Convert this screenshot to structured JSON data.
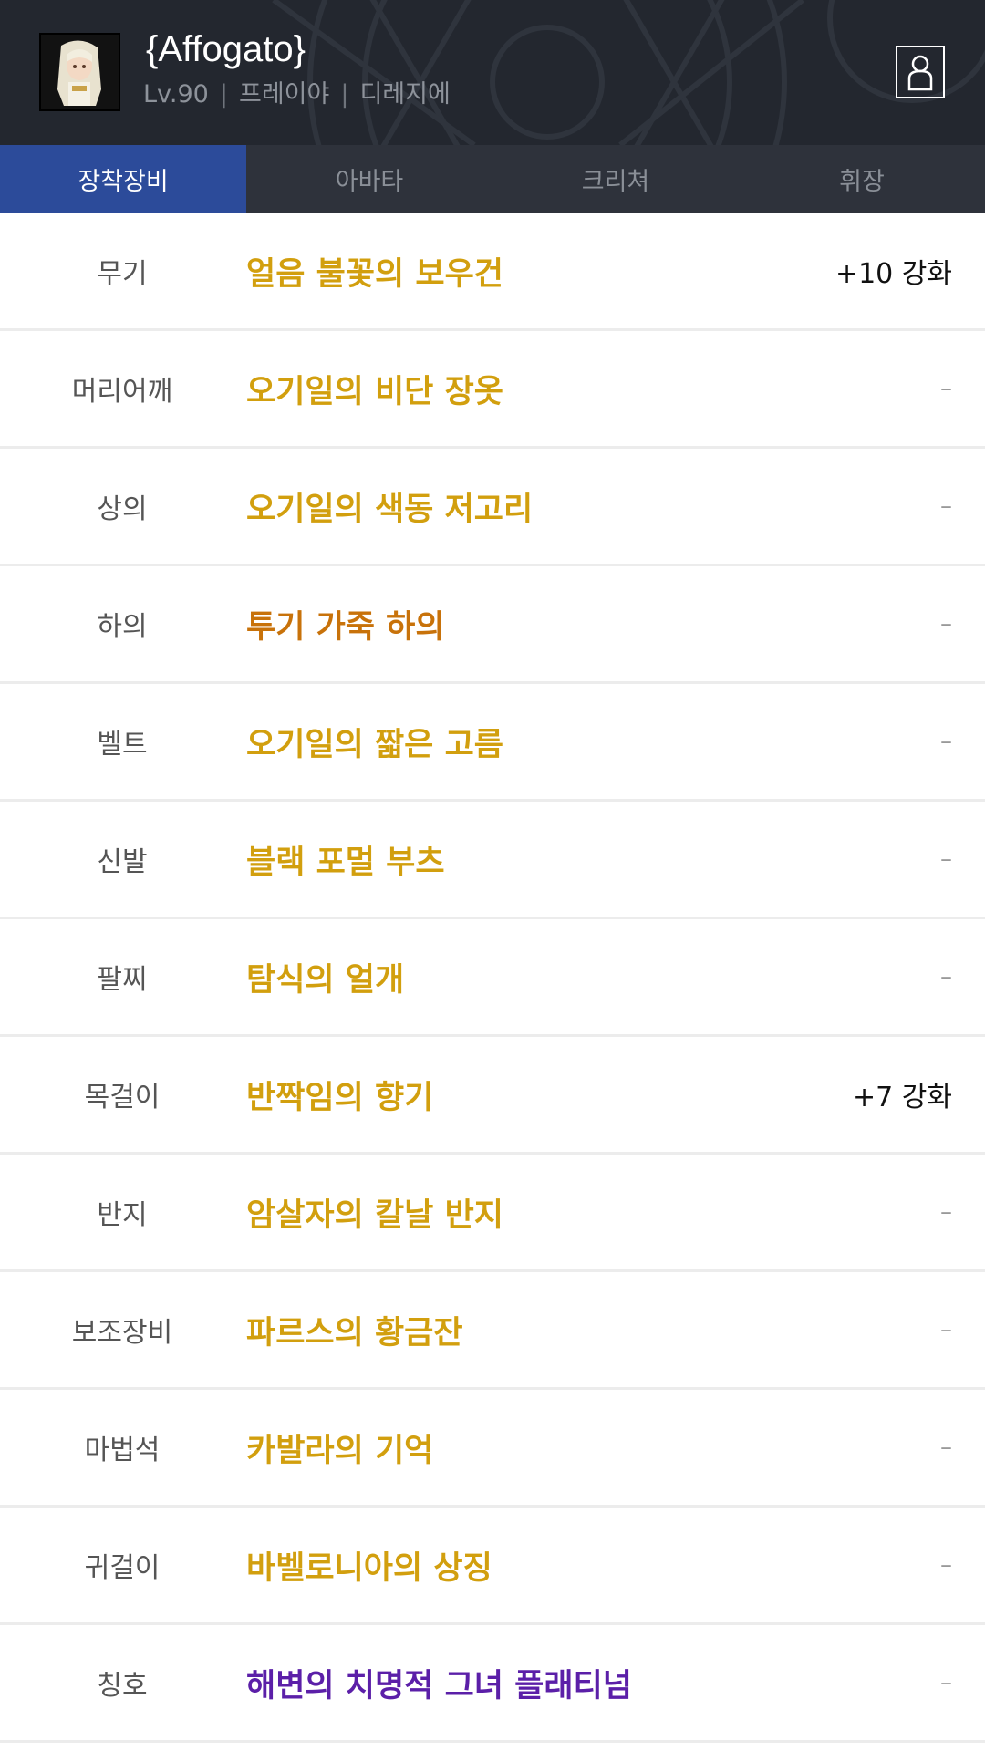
{
  "header": {
    "character_name": "{Affogato}",
    "level": "Lv.90",
    "class": "프레이야",
    "server": "디레지에",
    "separator": "|"
  },
  "tabs": [
    {
      "label": "장착장비",
      "active": true
    },
    {
      "label": "아바타",
      "active": false
    },
    {
      "label": "크리쳐",
      "active": false
    },
    {
      "label": "휘장",
      "active": false
    }
  ],
  "equipment": [
    {
      "slot": "무기",
      "item": "얼음 불꽃의 보우건",
      "enhance": "+10 강화",
      "rarity": "unique"
    },
    {
      "slot": "머리어깨",
      "item": "오기일의 비단 장옷",
      "enhance": "–",
      "rarity": "unique"
    },
    {
      "slot": "상의",
      "item": "오기일의 색동 저고리",
      "enhance": "–",
      "rarity": "unique"
    },
    {
      "slot": "하의",
      "item": "투기 가죽 하의",
      "enhance": "–",
      "rarity": "legendary"
    },
    {
      "slot": "벨트",
      "item": "오기일의 짧은 고름",
      "enhance": "–",
      "rarity": "unique"
    },
    {
      "slot": "신발",
      "item": "블랙 포멀 부츠",
      "enhance": "–",
      "rarity": "unique"
    },
    {
      "slot": "팔찌",
      "item": "탐식의 얼개",
      "enhance": "–",
      "rarity": "unique"
    },
    {
      "slot": "목걸이",
      "item": "반짝임의 향기",
      "enhance": "+7 강화",
      "rarity": "unique"
    },
    {
      "slot": "반지",
      "item": "암살자의 칼날 반지",
      "enhance": "–",
      "rarity": "unique"
    },
    {
      "slot": "보조장비",
      "item": "파르스의 황금잔",
      "enhance": "–",
      "rarity": "unique"
    },
    {
      "slot": "마법석",
      "item": "카발라의 기억",
      "enhance": "–",
      "rarity": "unique"
    },
    {
      "slot": "귀걸이",
      "item": "바벨로니아의 상징",
      "enhance": "–",
      "rarity": "unique"
    },
    {
      "slot": "칭호",
      "item": "해변의 치명적 그녀 플래티넘",
      "enhance": "–",
      "rarity": "epic"
    }
  ],
  "colors": {
    "header_bg": "#23272f",
    "tab_active": "#2c4b9a",
    "unique": "#d29f0e",
    "legendary": "#c8720a",
    "epic": "#5b1fa8"
  },
  "icons": {
    "avatar": "character-portrait-icon",
    "profile": "user-profile-icon"
  }
}
